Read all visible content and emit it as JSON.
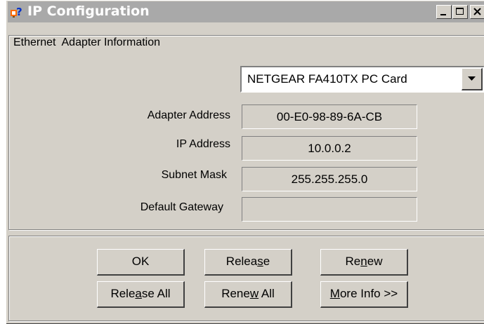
{
  "window": {
    "title": "IP Configuration",
    "colors": {
      "face": "#d4d0c8",
      "titlebar": "#a9a9a9",
      "title_text": "#ffffff"
    }
  },
  "titlebar_buttons": {
    "minimize_icon": "minimize-icon",
    "maximize_icon": "maximize-icon",
    "close_icon": "close-icon"
  },
  "adapter_group": {
    "title": "Ethernet  Adapter Information",
    "adapter_select": {
      "value": "NETGEAR FA410TX PC Card"
    },
    "fields": [
      {
        "label": "Adapter Address",
        "value": "00-E0-98-89-6A-CB"
      },
      {
        "label": "IP Address",
        "value": "10.0.0.2"
      },
      {
        "label": "Subnet Mask",
        "value": "255.255.255.0"
      },
      {
        "label": "Default Gateway",
        "value": ""
      }
    ]
  },
  "buttons": {
    "ok": "OK",
    "release_pre": "Relea",
    "release_u": "s",
    "release_post": "e",
    "renew_pre": "Re",
    "renew_u": "n",
    "renew_post": "ew",
    "release_all_pre": "Rele",
    "release_all_u": "a",
    "release_all_post": "se All",
    "renew_all_pre": "Rene",
    "renew_all_u": "w",
    "renew_all_post": " All",
    "more_info_pre": "",
    "more_info_u": "M",
    "more_info_post": "ore Info >>"
  }
}
